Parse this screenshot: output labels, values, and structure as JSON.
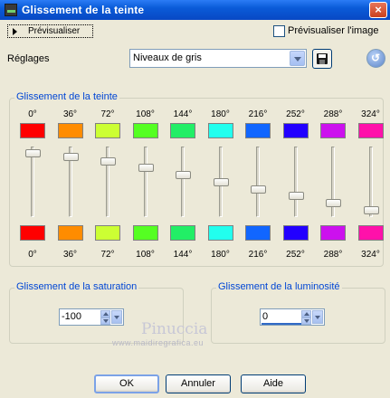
{
  "window": {
    "title": "Glissement de la teinte",
    "close_glyph": "×"
  },
  "toolbar": {
    "preview_label": "Prévisualiser",
    "preview_image_label": "Prévisualiser l'image",
    "preview_image_checked": false
  },
  "settings": {
    "label": "Réglages",
    "selected": "Niveaux de gris",
    "save_icon": "save-disk-icon",
    "reset_icon": "reset-icon"
  },
  "hue_shift": {
    "title": "Glissement de la teinte",
    "channels": [
      {
        "label": "0°",
        "color": "#ff0000",
        "level": 0.96
      },
      {
        "label": "36°",
        "color": "#ff8c00",
        "level": 0.9
      },
      {
        "label": "72°",
        "color": "#ccff33",
        "level": 0.82
      },
      {
        "label": "108°",
        "color": "#55ff22",
        "level": 0.72
      },
      {
        "label": "144°",
        "color": "#22ee66",
        "level": 0.61
      },
      {
        "label": "180°",
        "color": "#22ffee",
        "level": 0.49
      },
      {
        "label": "216°",
        "color": "#1166ff",
        "level": 0.37
      },
      {
        "label": "252°",
        "color": "#2200ff",
        "level": 0.28
      },
      {
        "label": "288°",
        "color": "#cc11ee",
        "level": 0.16
      },
      {
        "label": "324°",
        "color": "#ff11aa",
        "level": 0.04
      }
    ]
  },
  "saturation": {
    "title": "Glissement de la saturation",
    "value": "-100"
  },
  "luminosity": {
    "title": "Glissement de la luminosité",
    "value": "0"
  },
  "watermark": {
    "name": "Pinuccia",
    "url": "www.maidiregrafica.eu"
  },
  "buttons": {
    "ok": "OK",
    "cancel": "Annuler",
    "help": "Aide"
  }
}
